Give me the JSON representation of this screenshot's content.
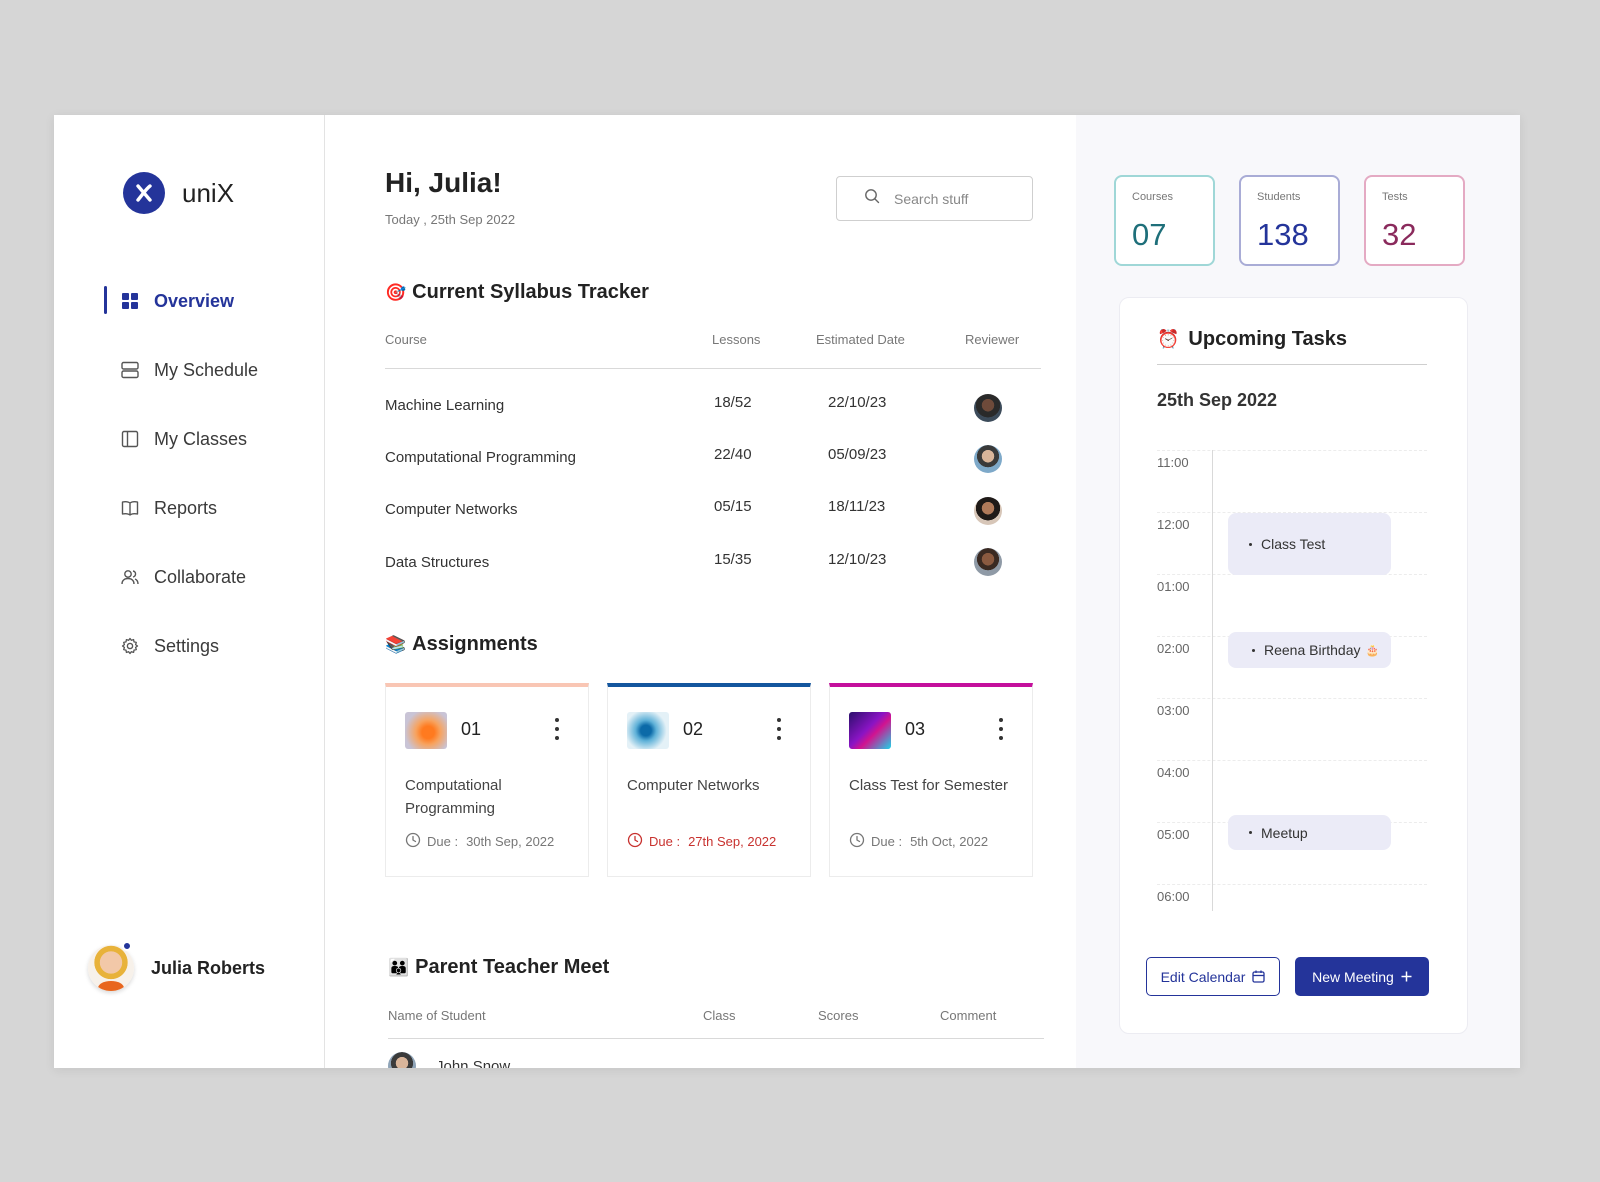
{
  "colors": {
    "brand": "#24349a",
    "late": "#c8322f",
    "courses_border": "#9fd7d7",
    "students_border": "#a9acd6",
    "tests_border": "#e4aac3",
    "card1_accent": "#f9c6b4",
    "card2_accent": "#14569e",
    "card3_accent": "#c4109c"
  },
  "app": {
    "name": "uniX"
  },
  "sidebar": {
    "nav": [
      {
        "label": "Overview",
        "icon": "grid-icon",
        "active": true
      },
      {
        "label": "My Schedule",
        "icon": "schedule-icon"
      },
      {
        "label": "My Classes",
        "icon": "classes-icon"
      },
      {
        "label": "Reports",
        "icon": "book-icon"
      },
      {
        "label": "Collaborate",
        "icon": "users-icon"
      },
      {
        "label": "Settings",
        "icon": "gear-icon"
      }
    ],
    "user": {
      "name": "Julia Roberts"
    }
  },
  "header": {
    "greeting": "Hi, Julia!",
    "date": "Today , 25th Sep 2022",
    "search_placeholder": "Search stuff"
  },
  "syllabus": {
    "title": "Current Syllabus Tracker",
    "emoji": "🎯",
    "columns": [
      "Course",
      "Lessons",
      "Estimated Date",
      "Reviewer"
    ],
    "rows": [
      {
        "course": "Machine Learning",
        "lessons": "18/52",
        "date": "22/10/23"
      },
      {
        "course": "Computational Programming",
        "lessons": "22/40",
        "date": "05/09/23"
      },
      {
        "course": "Computer Networks",
        "lessons": "05/15",
        "date": "18/11/23"
      },
      {
        "course": "Data Structures",
        "lessons": "15/35",
        "date": "12/10/23"
      }
    ]
  },
  "assignments": {
    "title": "Assignments",
    "emoji": "📚",
    "due_label": "Due :",
    "cards": [
      {
        "num": "01",
        "title": "Computational Programming",
        "due": "30th Sep, 2022",
        "late": false
      },
      {
        "num": "02",
        "title": "Computer Networks",
        "due": "27th Sep, 2022",
        "late": true
      },
      {
        "num": "03",
        "title": "Class Test for Semester",
        "due": "5th Oct, 2022",
        "late": false
      }
    ]
  },
  "ptm": {
    "title": "Parent Teacher Meet",
    "emoji": "👪",
    "columns": [
      "Name of Student",
      "Class",
      "Scores",
      "Comment"
    ],
    "rows": [
      {
        "name": "John Snow"
      }
    ]
  },
  "stats": [
    {
      "label": "Courses",
      "value": "07"
    },
    {
      "label": "Students",
      "value": "138"
    },
    {
      "label": "Tests",
      "value": "32"
    }
  ],
  "tasks": {
    "title": "Upcoming Tasks",
    "emoji": "⏰",
    "date": "25th Sep 2022",
    "times": [
      "11:00",
      "12:00",
      "01:00",
      "02:00",
      "03:00",
      "04:00",
      "05:00",
      "06:00"
    ],
    "events": [
      {
        "label": "Class Test"
      },
      {
        "label": "Reena Birthday",
        "emoji": "🎂"
      },
      {
        "label": "Meetup"
      }
    ],
    "edit_label": "Edit Calendar",
    "new_label": "New Meeting"
  }
}
